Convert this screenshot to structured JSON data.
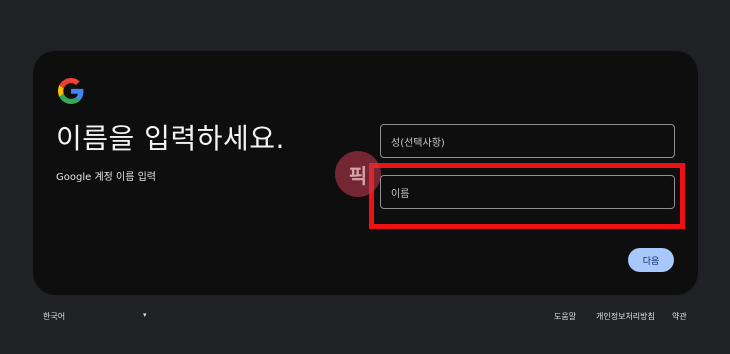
{
  "card": {
    "headline": "이름을 입력하세요.",
    "subtitle": "Google 계정 이름 입력"
  },
  "form": {
    "last_name_placeholder": "성(선택사항)",
    "first_name_placeholder": "이름",
    "next_label": "다음"
  },
  "watermark": {
    "text": "픽"
  },
  "footer": {
    "language": "한국어",
    "help": "도움말",
    "privacy": "개인정보처리방침",
    "terms": "약관"
  },
  "colors": {
    "background": "#202124",
    "card": "#0e0e0f",
    "highlight": "#ee1111",
    "button": "#a8c7fa"
  },
  "icons": {
    "logo": "google-g-icon",
    "language_caret": "caret-down-icon"
  }
}
